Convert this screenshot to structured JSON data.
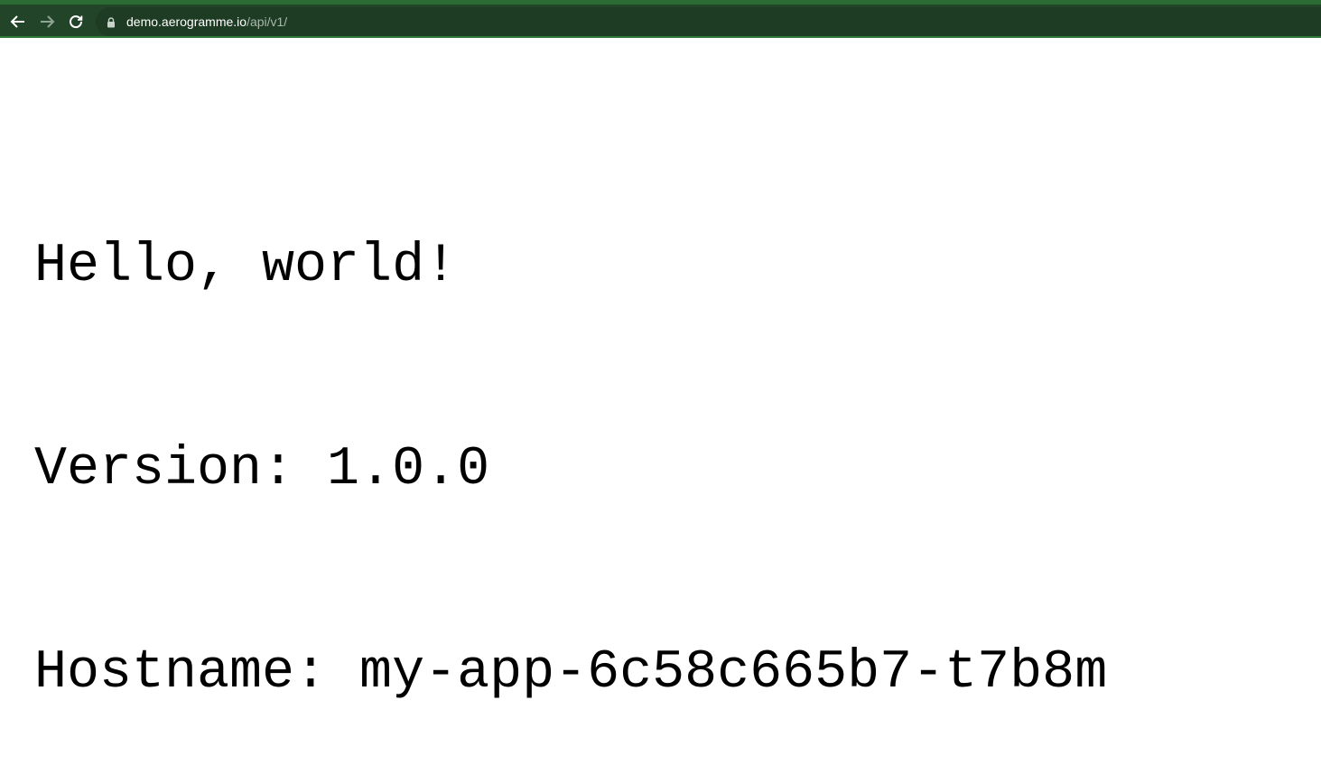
{
  "browser": {
    "url_host": "demo.aerogramme.io",
    "url_path": "/api/v1/",
    "back_icon": "arrow-left-icon",
    "forward_icon": "arrow-right-icon",
    "reload_icon": "reload-icon",
    "lock_icon": "lock-icon"
  },
  "page": {
    "lines": [
      "Hello, world!",
      "Version: 1.0.0",
      "Hostname: my-app-6c58c665b7-t7b8m"
    ]
  },
  "colors": {
    "toolbar": "#22452a",
    "omnibox": "#1e3b24",
    "url_text": "#ffffff",
    "url_path": "#a9b9ac"
  }
}
